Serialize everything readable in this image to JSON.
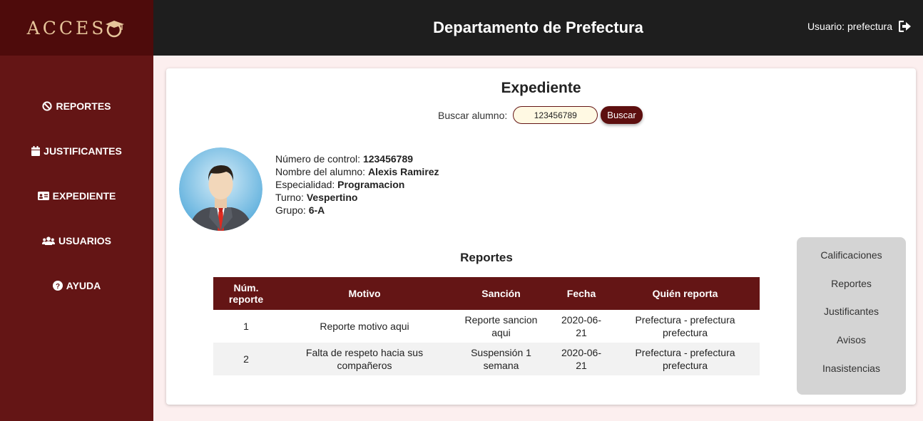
{
  "sidebar": {
    "logo": "ACCES",
    "items": [
      {
        "label": "REPORTES",
        "icon": "ban-icon"
      },
      {
        "label": "JUSTIFICANTES",
        "icon": "calendar-icon"
      },
      {
        "label": "EXPEDIENTE",
        "icon": "id-card-icon"
      },
      {
        "label": "USUARIOS",
        "icon": "users-icon"
      },
      {
        "label": "AYUDA",
        "icon": "question-circle-icon"
      }
    ]
  },
  "header": {
    "title": "Departamento de Prefectura",
    "user_label": "Usuario: prefectura",
    "logout_icon": "sign-out-icon"
  },
  "main": {
    "title": "Expediente",
    "search": {
      "label": "Buscar alumno:",
      "value": "123456789",
      "button_label": "Buscar"
    },
    "student": {
      "control_label": "Número de control:",
      "control_value": "123456789",
      "name_label": "Nombre del alumno:",
      "name_value": "Alexis Ramirez",
      "specialty_label": "Especialidad:",
      "specialty_value": "Programacion",
      "shift_label": "Turno:",
      "shift_value": "Vespertino",
      "group_label": "Grupo:",
      "group_value": "6-A"
    },
    "reports": {
      "title": "Reportes",
      "columns": [
        "Núm. reporte",
        "Motivo",
        "Sanción",
        "Fecha",
        "Quién reporta"
      ],
      "rows": [
        [
          "1",
          "Reporte motivo aqui",
          "Reporte sancion aqui",
          "2020-06-21",
          "Prefectura - prefectura prefectura"
        ],
        [
          "2",
          "Falta de respeto hacia sus compañeros",
          "Suspensión 1 semana",
          "2020-06-21",
          "Prefectura - prefectura prefectura"
        ]
      ]
    },
    "side_menu": [
      "Calificaciones",
      "Reportes",
      "Justificantes",
      "Avisos",
      "Inasistencias"
    ]
  },
  "colors": {
    "sidebar": "#641515",
    "logo_bg": "#4e0b0b",
    "topbar": "#1e1e1e",
    "page_bg": "#fcefef",
    "logo_gold": "#e6c49a",
    "table_header": "#641515",
    "side_menu_bg": "#d4d4d4"
  }
}
